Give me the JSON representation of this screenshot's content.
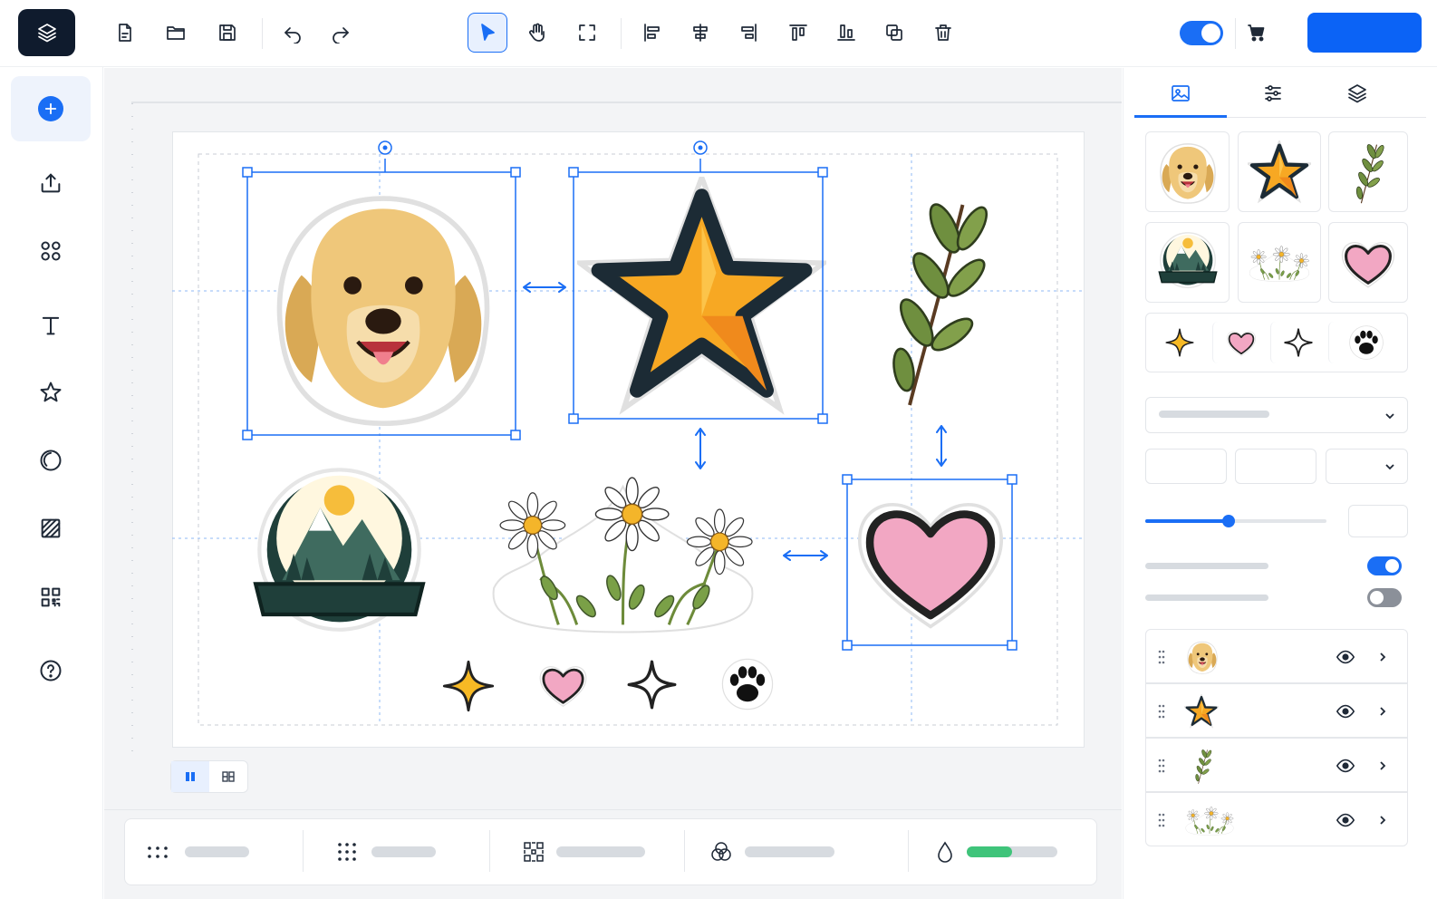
{
  "toolbar": {
    "file_icons": [
      "new-document-icon",
      "open-folder-icon",
      "save-icon"
    ],
    "history_icons": [
      "undo-icon",
      "redo-icon"
    ],
    "tool_icons": [
      "select-pointer-icon",
      "hand-pan-icon",
      "frame-icon"
    ],
    "active_tool": "select-pointer-icon",
    "arrange_icons": [
      "align-left-icon",
      "align-center-icon",
      "align-right-icon",
      "align-top-icon",
      "align-bottom-icon",
      "duplicate-icon",
      "delete-icon"
    ],
    "toggle_on": true,
    "cart_icon": "cart-icon",
    "cta_label": ""
  },
  "sidebar": {
    "items": [
      "add-icon",
      "upload-icon",
      "elements-grid-icon",
      "text-icon",
      "star-icon",
      "shape-circle-icon",
      "pattern-icon",
      "qr-code-icon",
      "help-icon"
    ],
    "active": "add-icon"
  },
  "canvas": {
    "stickers": [
      "golden-retriever-sticker",
      "star-sticker",
      "leaf-branch-sticker",
      "mountain-badge-sticker",
      "daisies-sticker",
      "heart-sticker",
      "sparkle-sticker",
      "small-heart-sticker",
      "outline-sparkle-sticker",
      "paw-sticker"
    ],
    "selected": [
      "golden-retriever-sticker",
      "star-sticker",
      "heart-sticker"
    ]
  },
  "view_toggle": [
    "single-page-view-icon",
    "multi-page-view-icon"
  ],
  "bottom_bar": {
    "items": [
      "dots-grid-3-icon",
      "dots-grid-4-icon",
      "halftone-icon",
      "blend-circles-icon",
      "opacity-drop-icon"
    ],
    "opacity_fill": 0.5,
    "accent": "#3fc47a"
  },
  "right_panel": {
    "tabs": [
      "image-icon",
      "adjustments-icon",
      "layers-icon"
    ],
    "active_tab": "image-icon",
    "library": [
      "dog",
      "star",
      "leaf",
      "badge",
      "daisies",
      "heart",
      "sparkle",
      "small-heart",
      "outline-sparkle",
      "paw"
    ],
    "slider_value": 0.46,
    "toggles": [
      true,
      false
    ],
    "layers": [
      "dog",
      "star",
      "leaf",
      "daisies"
    ]
  },
  "colors": {
    "accent": "#1a6ef5",
    "logo_bg": "#0f1b2d",
    "star": "#f7a823",
    "heart": "#f2a7c3",
    "leaf": "#6f8f3f"
  }
}
